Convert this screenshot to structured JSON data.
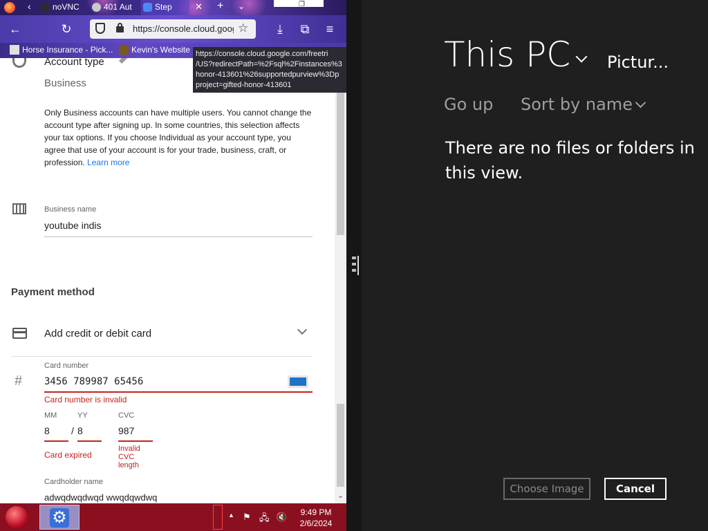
{
  "browser": {
    "tabs": [
      {
        "label": "noVNC"
      },
      {
        "label": "401 Aut"
      },
      {
        "label": "Step"
      }
    ],
    "url": "https://console.cloud.google.com",
    "bookmarks": [
      {
        "label": "Horse Insurance - Pick..."
      },
      {
        "label": "Kevin's Website"
      }
    ],
    "tooltip_lines": [
      "https://console.cloud.google.com/freetri",
      "/US?redirectPath=%2Fsql%2Finstances%3",
      "honor-413601%26supportedpurview%3Dp",
      "project=gifted-honor-413601"
    ]
  },
  "form": {
    "account_type_label": "Account type",
    "account_type_value": "Business",
    "account_paragraph": "Only Business accounts can have multiple users. You cannot change the account type after signing up. In some countries, this selection affects your tax options. If you choose Individual as your account type, you agree that use of your account is for your trade, business, craft, or profession.",
    "learn_more": "Learn more",
    "business_name_label": "Business name",
    "business_name_value": "youtube indis",
    "payment_method_heading": "Payment method",
    "add_card_label": "Add credit or debit card",
    "card_number_label": "Card number",
    "card_number_value": "3456  789987  65456",
    "card_number_error": "Card number is invalid",
    "mm_label": "MM",
    "yy_label": "YY",
    "cvc_label": "CVC",
    "mm_value": "8",
    "slash": "/",
    "yy_value": "8",
    "cvc_value": "987",
    "expired_error": "Card expired",
    "cvc_error_lines": [
      "Invalid",
      "CVC",
      "length"
    ],
    "cardholder_label": "Cardholder name",
    "cardholder_value": "adwqdwqdwqd wwqdqwdwq"
  },
  "picker": {
    "location": "This PC",
    "folder": "Pictur...",
    "go_up": "Go up",
    "sort": "Sort by name",
    "empty_lines": [
      "There are no files or folders in",
      "this view."
    ],
    "choose_button": "Choose Image",
    "cancel_button": "Cancel"
  },
  "taskbar": {
    "time": "9:49 PM",
    "date": "2/6/2024"
  }
}
